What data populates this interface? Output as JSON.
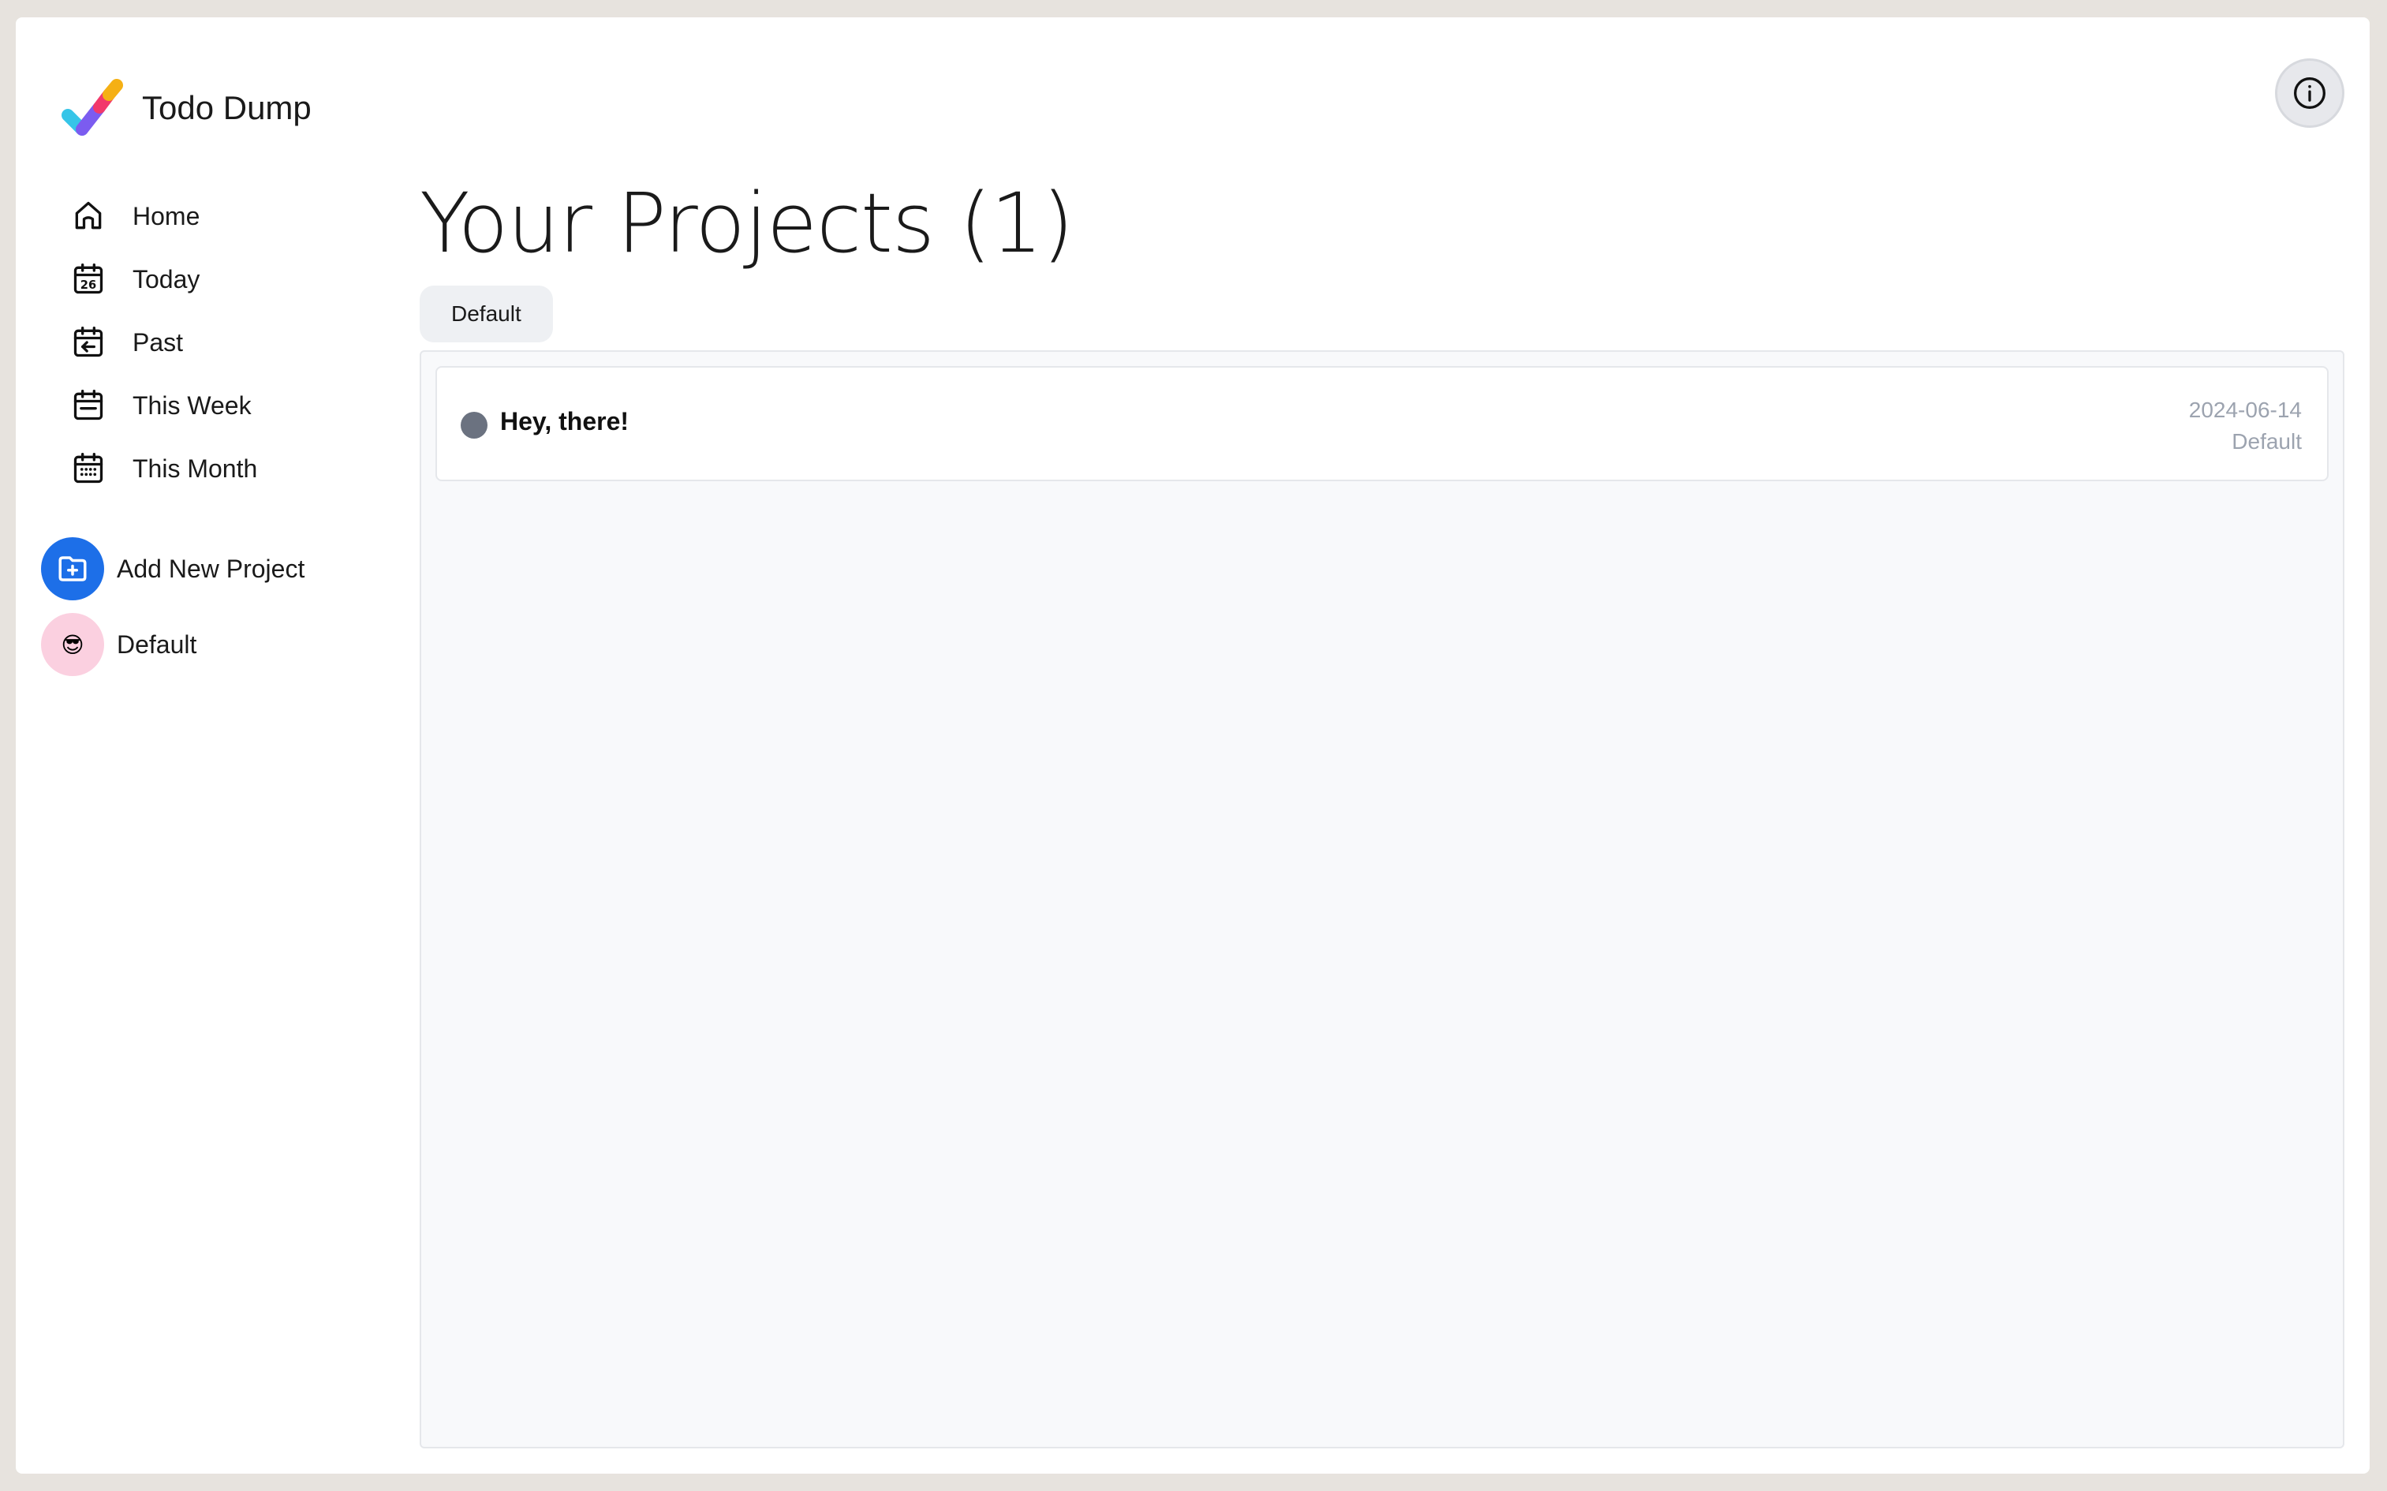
{
  "app": {
    "title": "Todo Dump"
  },
  "header": {
    "info_icon": "info-icon"
  },
  "sidebar": {
    "nav": [
      {
        "label": "Home",
        "icon": "home-icon"
      },
      {
        "label": "Today",
        "icon": "calendar-today-icon",
        "icon_text": "26"
      },
      {
        "label": "Past",
        "icon": "calendar-past-icon"
      },
      {
        "label": "This Week",
        "icon": "calendar-week-icon"
      },
      {
        "label": "This Month",
        "icon": "calendar-month-icon"
      }
    ],
    "add_project": {
      "label": "Add New Project",
      "icon": "folder-plus-icon",
      "color": "#1d6fe8"
    },
    "projects": [
      {
        "label": "Default",
        "emoji": "😎",
        "color": "#fbd0e0"
      }
    ]
  },
  "main": {
    "title": "Your Projects (1)",
    "filter": "Default",
    "todos": [
      {
        "title": "Hey, there!",
        "date": "2024-06-14",
        "project": "Default",
        "status_color": "#6b7280"
      }
    ]
  }
}
